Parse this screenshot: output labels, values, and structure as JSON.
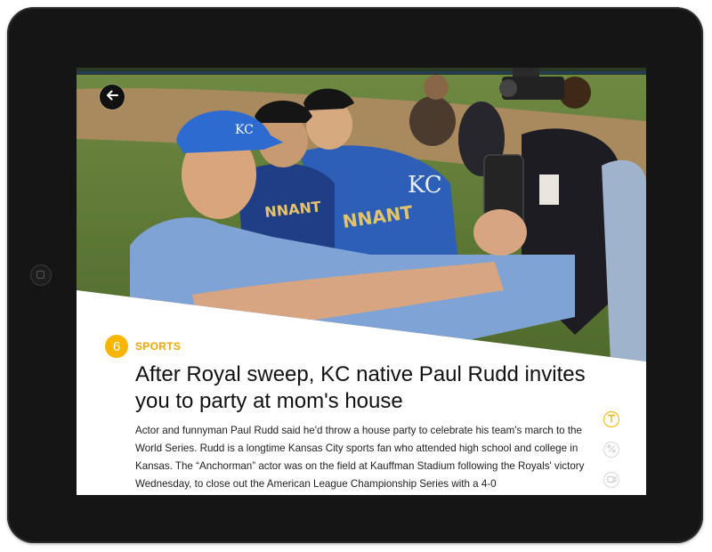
{
  "article": {
    "rank": "6",
    "category": "SPORTS",
    "headline": "After Royal sweep, KC native Paul Rudd invites you to party at mom's house",
    "body": "Actor and funnyman Paul Rudd said he'd throw a house party to celebrate his team's march to the World Series. Rudd is a longtime Kansas City sports fan who attended high school and college in Kansas. The “Anchorman” actor was on the field at Kauffman Stadium following the Royals' victory Wednesday, to close out the American League Championship Series with a 4-0"
  },
  "icons": {
    "back": "arrow-left-icon",
    "text": "text-t-icon",
    "percent": "percent-icon",
    "video": "video-camera-icon"
  },
  "colors": {
    "accent": "#f7b500",
    "headline": "#111111",
    "body": "#222222"
  }
}
